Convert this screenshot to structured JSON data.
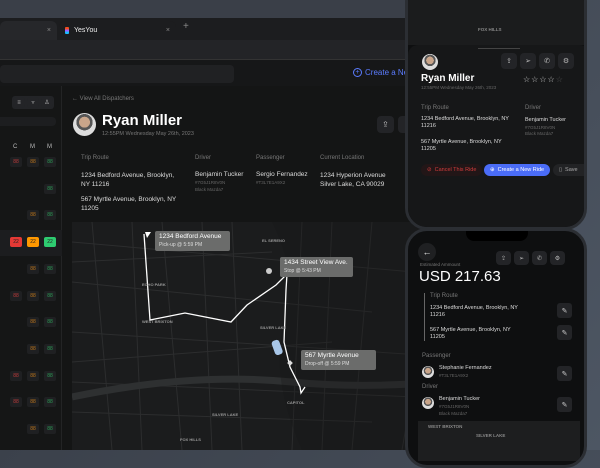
{
  "browser": {
    "tab_title": "YesYou",
    "new_tab": "+",
    "close": "×"
  },
  "header": {
    "create_label": "Create a New"
  },
  "sidebar": {
    "columns": [
      "C",
      "M",
      "M"
    ],
    "rows": [
      [
        "88",
        "88",
        "88"
      ],
      [
        "",
        "",
        "88"
      ],
      [
        "",
        "88",
        "88"
      ],
      [
        "22",
        "22",
        "22"
      ],
      [
        "",
        "88",
        "88"
      ],
      [
        "88",
        "88",
        "88"
      ],
      [
        "",
        "88",
        "88"
      ],
      [
        "",
        "88",
        "88"
      ],
      [
        "88",
        "88",
        "88"
      ],
      [
        "88",
        "88",
        "88"
      ],
      [
        "",
        "88",
        "88"
      ]
    ]
  },
  "detail": {
    "back": "View All Dispatchers",
    "name": "Ryan Miller",
    "datetime": "12:55PM Wednesday May 26th, 2023",
    "trip_route_label": "Trip Route",
    "route": [
      "1234 Bedford Avenue, Brooklyn, NY 11216",
      "567 Myrtle Avenue, Brooklyn, NY 11205"
    ],
    "driver_label": "Driver",
    "driver_name": "Benjamin Tucker",
    "driver_id": "#7G5J1R8V0N",
    "driver_car": "Black Mazda7",
    "passenger_label": "Passenger",
    "passenger_name": "Sergio Fernandez",
    "passenger_id": "#T3L7E1A9X2",
    "location_label": "Current Location",
    "location": "1234 Hyperion Avenue Silver Lake, CA 90029"
  },
  "map": {
    "pickup_title": "1234 Bedford Avenue",
    "pickup_sub": "Pick-up @ 5:59 PM",
    "stop_title": "1434 Street View Ave.",
    "stop_sub": "Stop @ 5:43 PM",
    "drop_title": "567 Myrtle Avenue",
    "drop_sub": "Drop-off @ 5:59 PM",
    "labels": [
      "EL SERENO",
      "WEST BRIXTON",
      "SILVER LAKE",
      "FOX HILLS",
      "ECHO PARK",
      "CAPITOL",
      "SILVER LAKE"
    ]
  },
  "phone1": {
    "map_label": "FOX HILLS",
    "name": "Ryan Miller",
    "datetime": "12:55PM Wednesday May 26th, 2023",
    "trip_route_label": "Trip Route",
    "route": [
      "1234 Bedford Avenue, Brooklyn, NY 11216",
      "567 Myrtle Avenue, Brooklyn, NY 11205"
    ],
    "driver_label": "Driver",
    "driver_name": "Benjamin Tucker",
    "driver_id": "#7G5J1R8V0N",
    "driver_car": "Black Mazda7",
    "rating": 4,
    "rating_max": 5,
    "cancel": "Cancel This Ride",
    "create": "Create a New Ride",
    "save": "Save"
  },
  "phone2": {
    "amount_label": "Estimated Ammount",
    "amount": "USD 217.63",
    "trip_route_label": "Trip Route",
    "route": [
      "1234 Bedford Avenue, Brooklyn, NY 11216",
      "567 Myrtle Avenue, Brooklyn, NY 11205"
    ],
    "passenger_label": "Passenger",
    "passenger_name": "Stephanie Fernandez",
    "passenger_id": "#T3L7E1A9X2",
    "driver_label": "Driver",
    "driver_name": "Benjamin Tucker",
    "driver_id": "#7G5J1R8V0N",
    "driver_car": "Black Mazda7",
    "map_labels": [
      "WEST BRIXTON",
      "SILVER LAKE"
    ]
  },
  "colors": {
    "accent": "#4a6cf7",
    "red": "#e53935",
    "orange": "#ff9800",
    "green": "#2ecc71"
  }
}
